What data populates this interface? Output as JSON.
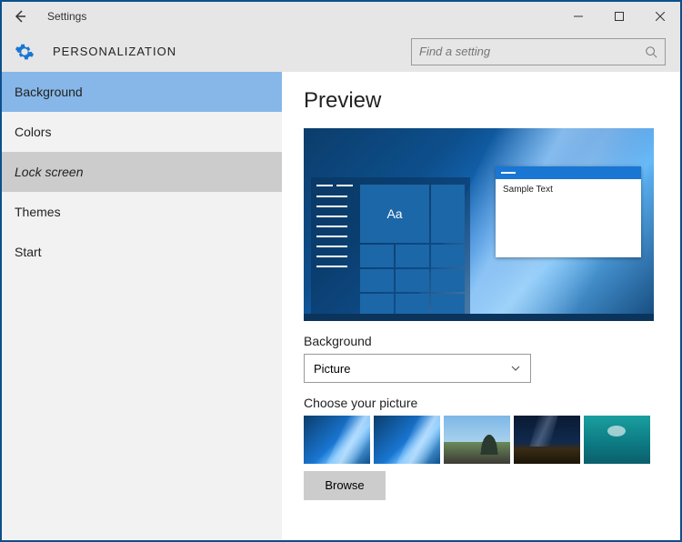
{
  "titlebar": {
    "title": "Settings"
  },
  "header": {
    "section": "PERSONALIZATION",
    "search_placeholder": "Find a setting"
  },
  "sidebar": {
    "items": [
      {
        "label": "Background",
        "state": "selected"
      },
      {
        "label": "Colors",
        "state": ""
      },
      {
        "label": "Lock screen",
        "state": "hovered"
      },
      {
        "label": "Themes",
        "state": ""
      },
      {
        "label": "Start",
        "state": ""
      }
    ]
  },
  "main": {
    "preview_heading": "Preview",
    "sample_text": "Sample Text",
    "tile_text": "Aa",
    "bg_label": "Background",
    "bg_dropdown_value": "Picture",
    "choose_label": "Choose your picture",
    "browse_label": "Browse"
  }
}
